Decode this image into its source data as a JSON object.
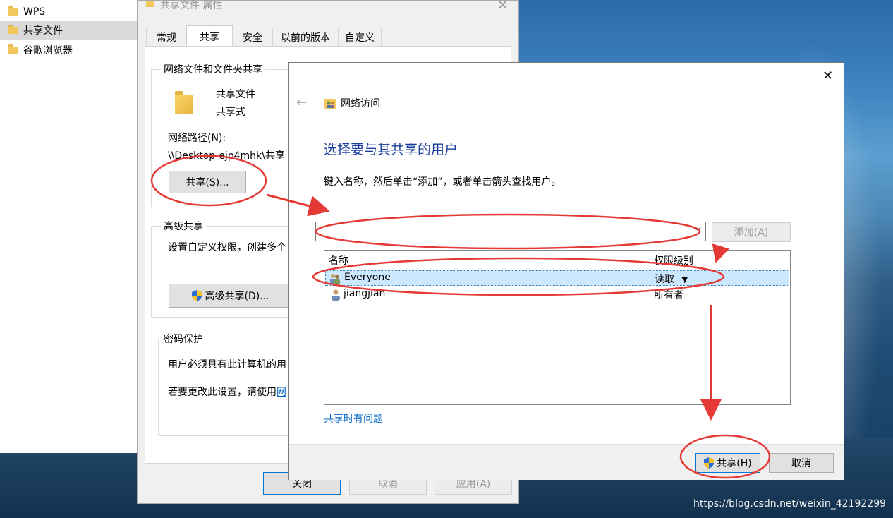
{
  "explorer": {
    "items": [
      {
        "label": "WPS",
        "selected": false
      },
      {
        "label": "共享文件",
        "selected": true
      },
      {
        "label": "谷歌浏览器",
        "selected": false
      }
    ]
  },
  "properties": {
    "title": "共享文件 属性",
    "tabs": [
      "常规",
      "共享",
      "安全",
      "以前的版本",
      "自定义"
    ],
    "active_tab": "共享",
    "network_share": {
      "group_title": "网络文件和文件夹共享",
      "name": "共享文件",
      "status": "共享式",
      "path_label": "网络路径(N):",
      "path_value": "\\\\Desktop-ejp4mhk\\共享",
      "share_button": "共享(S)..."
    },
    "advanced": {
      "group_title": "高级共享",
      "description": "设置自定义权限，创建多个",
      "button": "高级共享(D)..."
    },
    "password": {
      "group_title": "密码保护",
      "line1": "用户必须具有此计算机的用",
      "line2": "若要更改此设置，请使用",
      "line2_link": "网"
    },
    "buttons": {
      "close": "关闭",
      "cancel": "取消",
      "apply": "应用(A)"
    }
  },
  "dialog": {
    "title": "网络访问",
    "heading": "选择要与其共享的用户",
    "instruction": "键入名称，然后单击“添加”，或者单击箭头查找用户。",
    "combo_value": "",
    "add_button": "添加(A)",
    "columns": {
      "name": "名称",
      "permission": "权限级别"
    },
    "users": [
      {
        "name": "Everyone",
        "permission": "读取",
        "selected": true
      },
      {
        "name": "jiangjian",
        "permission": "所有者",
        "selected": false
      }
    ],
    "help_link": "共享时有问题",
    "share_button": "共享(H)",
    "cancel_button": "取消"
  },
  "watermark": "https://blog.csdn.net/weixin_42192299",
  "colors": {
    "accent": "#1a3e9c",
    "link": "#0066cc",
    "annotation": "#e53935",
    "selection": "#cce8ff"
  }
}
